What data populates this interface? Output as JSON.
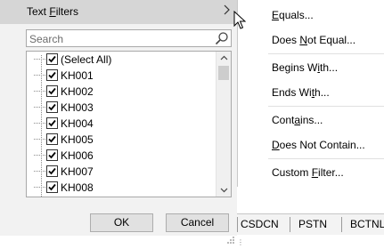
{
  "filter_panel": {
    "text_filters_prefix": "Text ",
    "text_filters_accel": "F",
    "text_filters_suffix": "ilters",
    "search_placeholder": "Search",
    "items": [
      {
        "label": "(Select All)",
        "checked": true
      },
      {
        "label": "KH001",
        "checked": true
      },
      {
        "label": "KH002",
        "checked": true
      },
      {
        "label": "KH003",
        "checked": true
      },
      {
        "label": "KH004",
        "checked": true
      },
      {
        "label": "KH005",
        "checked": true
      },
      {
        "label": "KH006",
        "checked": true
      },
      {
        "label": "KH007",
        "checked": true
      },
      {
        "label": "KH008",
        "checked": true
      }
    ],
    "ok_label": "OK",
    "cancel_label": "Cancel"
  },
  "submenu": {
    "items": [
      {
        "pre": "",
        "accel": "E",
        "post": "quals..."
      },
      {
        "pre": "Does ",
        "accel": "N",
        "post": "ot Equal..."
      },
      {
        "pre": "Begins W",
        "accel": "i",
        "post": "th..."
      },
      {
        "pre": "Ends Wi",
        "accel": "t",
        "post": "h..."
      },
      {
        "pre": "Cont",
        "accel": "a",
        "post": "ins..."
      },
      {
        "pre": "",
        "accel": "D",
        "post": "oes Not Contain..."
      },
      {
        "pre": "Custom ",
        "accel": "F",
        "post": "ilter..."
      }
    ]
  },
  "sheet_tabs": [
    "CSDCN",
    "PSTN",
    "BCTNL"
  ],
  "colors": {
    "panel_bg": "#f2f2f2",
    "highlight_row": "#d6d6d6",
    "button_bg": "#e1e1e1"
  },
  "icons": {
    "search": "magnifier-icon",
    "submenu_arrow": "chevron-right-icon",
    "check": "check-icon"
  }
}
